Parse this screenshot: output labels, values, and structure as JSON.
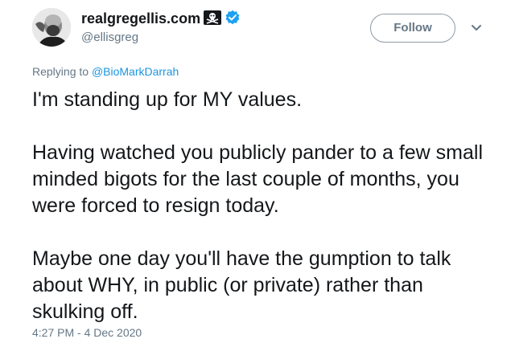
{
  "author": {
    "display_name": "realgregellis.com",
    "handle": "@ellisgreg",
    "flag_icon": "skull-crossbones-flag-icon",
    "verified_icon": "verified-badge-icon",
    "verified_color": "#1da1f2"
  },
  "actions": {
    "follow_label": "Follow",
    "menu_icon": "chevron-down-icon"
  },
  "reply": {
    "prefix": "Replying to ",
    "handle": "@BioMarkDarrah",
    "link_color": "#1b95e0"
  },
  "tweet": {
    "paragraphs": [
      "I'm standing up for MY values.",
      "Having watched you publicly pander to a few small minded bigots for the last couple of months, you were forced to resign today.",
      "Maybe one day you'll have the gumption to talk about WHY, in public (or private) rather than skulking off."
    ],
    "timestamp": "4:27 PM - 4 Dec 2020"
  }
}
